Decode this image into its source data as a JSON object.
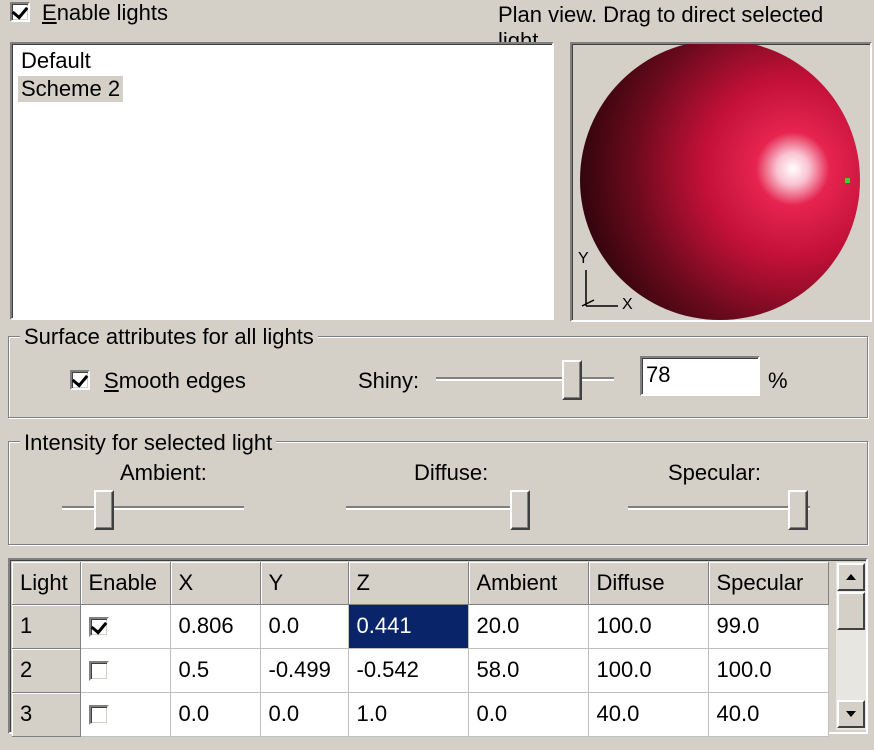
{
  "enable_lights": {
    "label_accel": "E",
    "label_rest": "nable lights",
    "checked": true
  },
  "plan_hint": "Plan view. Drag to direct selected light.",
  "schemes": {
    "items": [
      "Default",
      "Scheme 2"
    ],
    "selected_index": 1
  },
  "preview": {
    "axis_y": "Y",
    "axis_x": "X",
    "sphere_color": "#d9103c",
    "light_marker_color": "#3bd12e"
  },
  "surface": {
    "legend": "Surface attributes for all lights",
    "smooth_accel": "S",
    "smooth_rest": "mooth edges",
    "smooth_checked": true,
    "shiny_label": "Shiny:",
    "shiny_value": "78",
    "shiny_unit": "%",
    "shiny_level": 0.78
  },
  "intensity": {
    "legend": "Intensity for selected light",
    "ambient_label": "Ambient:",
    "ambient_level": 0.2,
    "diffuse_label": "Diffuse:",
    "diffuse_level": 1.0,
    "specular_label": "Specular:",
    "specular_level": 0.99
  },
  "table": {
    "headers": [
      "Light",
      "Enable",
      "X",
      "Y",
      "Z",
      "Ambient",
      "Diffuse",
      "Specular"
    ],
    "rows": [
      {
        "light": "1",
        "enabled": true,
        "x": "0.806",
        "y": "0.0",
        "z": "0.441",
        "ambient": "20.0",
        "diffuse": "100.0",
        "specular": "99.0"
      },
      {
        "light": "2",
        "enabled": false,
        "x": "0.5",
        "y": "-0.499",
        "z": "-0.542",
        "ambient": "58.0",
        "diffuse": "100.0",
        "specular": "100.0"
      },
      {
        "light": "3",
        "enabled": false,
        "x": "0.0",
        "y": "0.0",
        "z": "1.0",
        "ambient": "0.0",
        "diffuse": "40.0",
        "specular": "40.0"
      }
    ],
    "selected_cell": "z"
  },
  "colors": {
    "selection": "#0a246a",
    "list_selection": "#d4d0c8"
  }
}
